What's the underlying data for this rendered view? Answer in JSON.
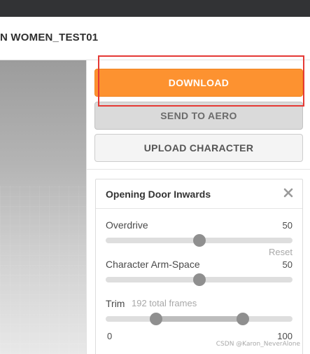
{
  "app": {
    "title": "N WOMEN_TEST01"
  },
  "actions": {
    "download_label": "DOWNLOAD",
    "send_to_aero_label": "SEND TO AERO",
    "upload_character_label": "UPLOAD CHARACTER"
  },
  "animation_card": {
    "title": "Opening Door Inwards",
    "close_icon": "close-icon",
    "overdrive": {
      "label": "Overdrive",
      "value": "50",
      "fraction": 0.5
    },
    "reset_label": "Reset",
    "arm_space": {
      "label": "Character Arm-Space",
      "value": "50",
      "fraction": 0.5
    },
    "trim": {
      "label": "Trim",
      "frames_label": "192 total frames",
      "min": "0",
      "max": "100",
      "start_fraction": 0.27,
      "end_fraction": 0.735
    }
  },
  "watermark": "CSDN @Karon_NeverAlone",
  "colors": {
    "download": "#fd9230",
    "highlight": "#e53935",
    "topbar": "#323335"
  }
}
